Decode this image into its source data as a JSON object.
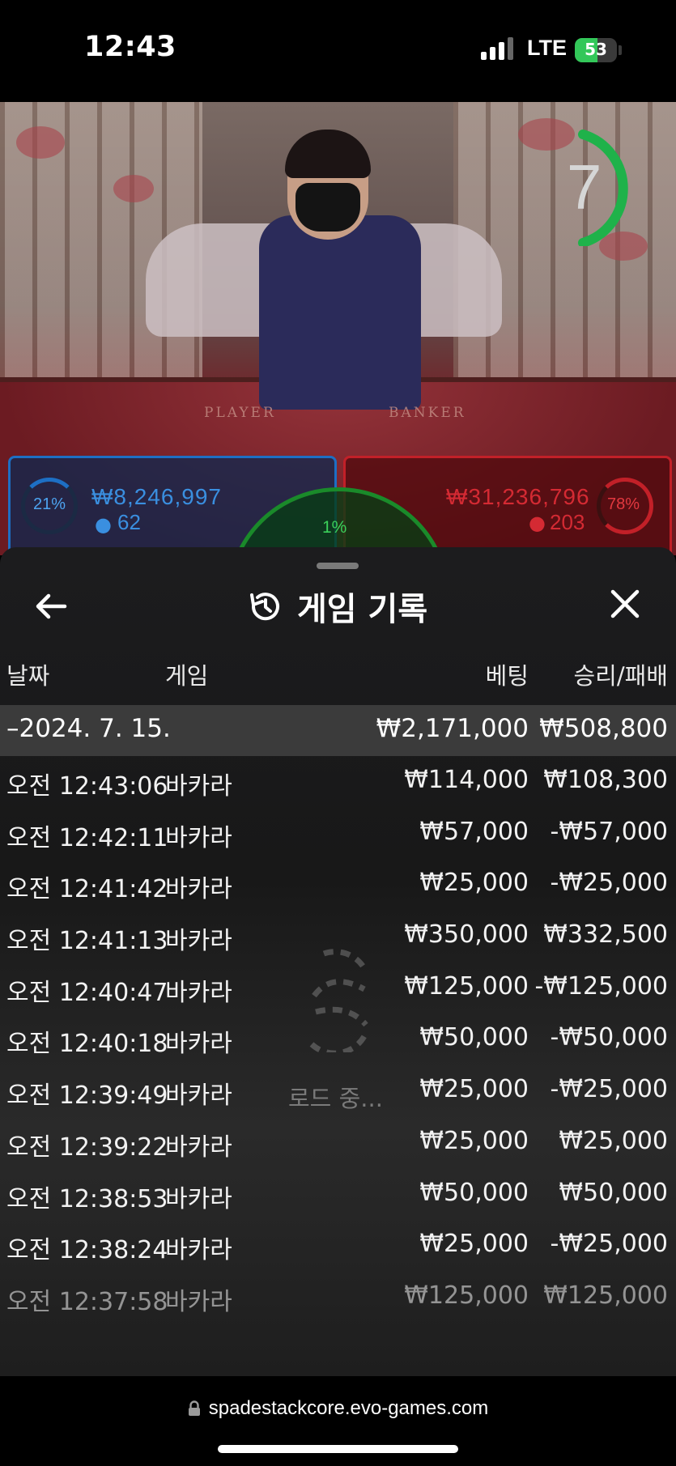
{
  "status_bar": {
    "time": "12:43",
    "network": "LTE",
    "battery": "53"
  },
  "video": {
    "timer": "7",
    "felt_labels": [
      "PLAYER",
      "BANKER"
    ],
    "player": {
      "percent": "21%",
      "amount": "₩8,246,997",
      "count": "62"
    },
    "banker": {
      "percent": "78%",
      "amount": "₩31,236,796",
      "count": "203"
    },
    "tie": {
      "percent": "1%"
    }
  },
  "sheet": {
    "title": "게임 기록",
    "columns": {
      "date": "날짜",
      "game": "게임",
      "bet": "베팅",
      "result": "승리/패배"
    },
    "summary": {
      "date": "–2024. 7. 15.",
      "bet": "₩2,171,000",
      "result": "₩508,800"
    },
    "rows": [
      {
        "time": "오전 12:43:06",
        "game": "바카라",
        "bet": "₩114,000",
        "result": "₩108,300"
      },
      {
        "time": "오전 12:42:11",
        "game": "바카라",
        "bet": "₩57,000",
        "result": "-₩57,000"
      },
      {
        "time": "오전 12:41:42",
        "game": "바카라",
        "bet": "₩25,000",
        "result": "-₩25,000"
      },
      {
        "time": "오전 12:41:13",
        "game": "바카라",
        "bet": "₩350,000",
        "result": "₩332,500"
      },
      {
        "time": "오전 12:40:47",
        "game": "바카라",
        "bet": "₩125,000",
        "result": "-₩125,000"
      },
      {
        "time": "오전 12:40:18",
        "game": "바카라",
        "bet": "₩50,000",
        "result": "-₩50,000"
      },
      {
        "time": "오전 12:39:49",
        "game": "바카라",
        "bet": "₩25,000",
        "result": "-₩25,000"
      },
      {
        "time": "오전 12:39:22",
        "game": "바카라",
        "bet": "₩25,000",
        "result": "₩25,000"
      },
      {
        "time": "오전 12:38:53",
        "game": "바카라",
        "bet": "₩50,000",
        "result": "₩50,000"
      },
      {
        "time": "오전 12:38:24",
        "game": "바카라",
        "bet": "₩25,000",
        "result": "-₩25,000"
      },
      {
        "time": "오전 12:37:58",
        "game": "바카라",
        "bet": "₩125,000",
        "result": "₩125,000"
      }
    ],
    "loading_text": "로드 중..."
  },
  "browser": {
    "url": "spadestackcore.evo-games.com"
  },
  "colors": {
    "player": "#1d6fc4",
    "banker": "#c22028",
    "tie": "#1a8a2a",
    "timer": "#1fb24a",
    "row_highlight": "#3b3b3b"
  }
}
